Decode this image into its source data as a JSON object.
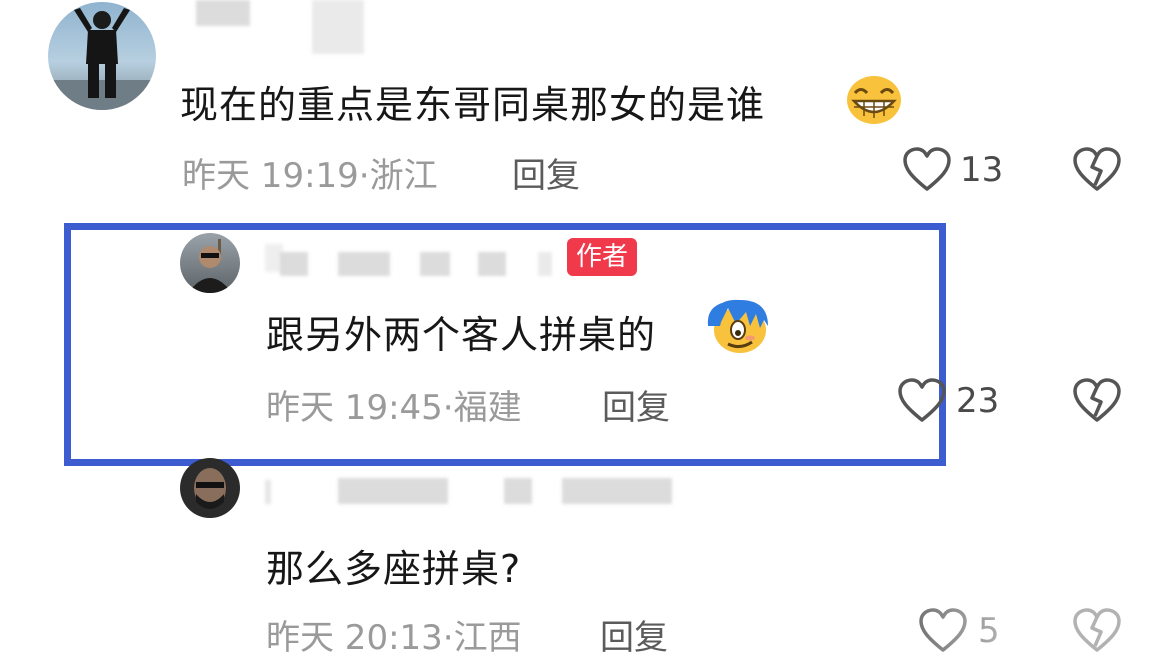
{
  "comments": [
    {
      "text": "现在的重点是东哥同桌那女的是谁",
      "emoji": "grinning-face",
      "time": "昨天 19:19",
      "location": "浙江",
      "reply_label": "回复",
      "likes": "13"
    },
    {
      "author_tag": "作者",
      "text": "跟另外两个客人拼桌的",
      "emoji": "cheeky-face",
      "time": "昨天 19:45",
      "location": "福建",
      "reply_label": "回复",
      "likes": "23",
      "highlighted": true,
      "highlight_color": "#3d5ccf"
    },
    {
      "text": "那么多座拼桌?",
      "time": "昨天 20:13",
      "location": "江西",
      "reply_label": "回复",
      "likes": "5"
    }
  ],
  "colors": {
    "tag_bg": "#f1394c",
    "meta_text": "#9a9a9a",
    "content_text": "#171717"
  }
}
